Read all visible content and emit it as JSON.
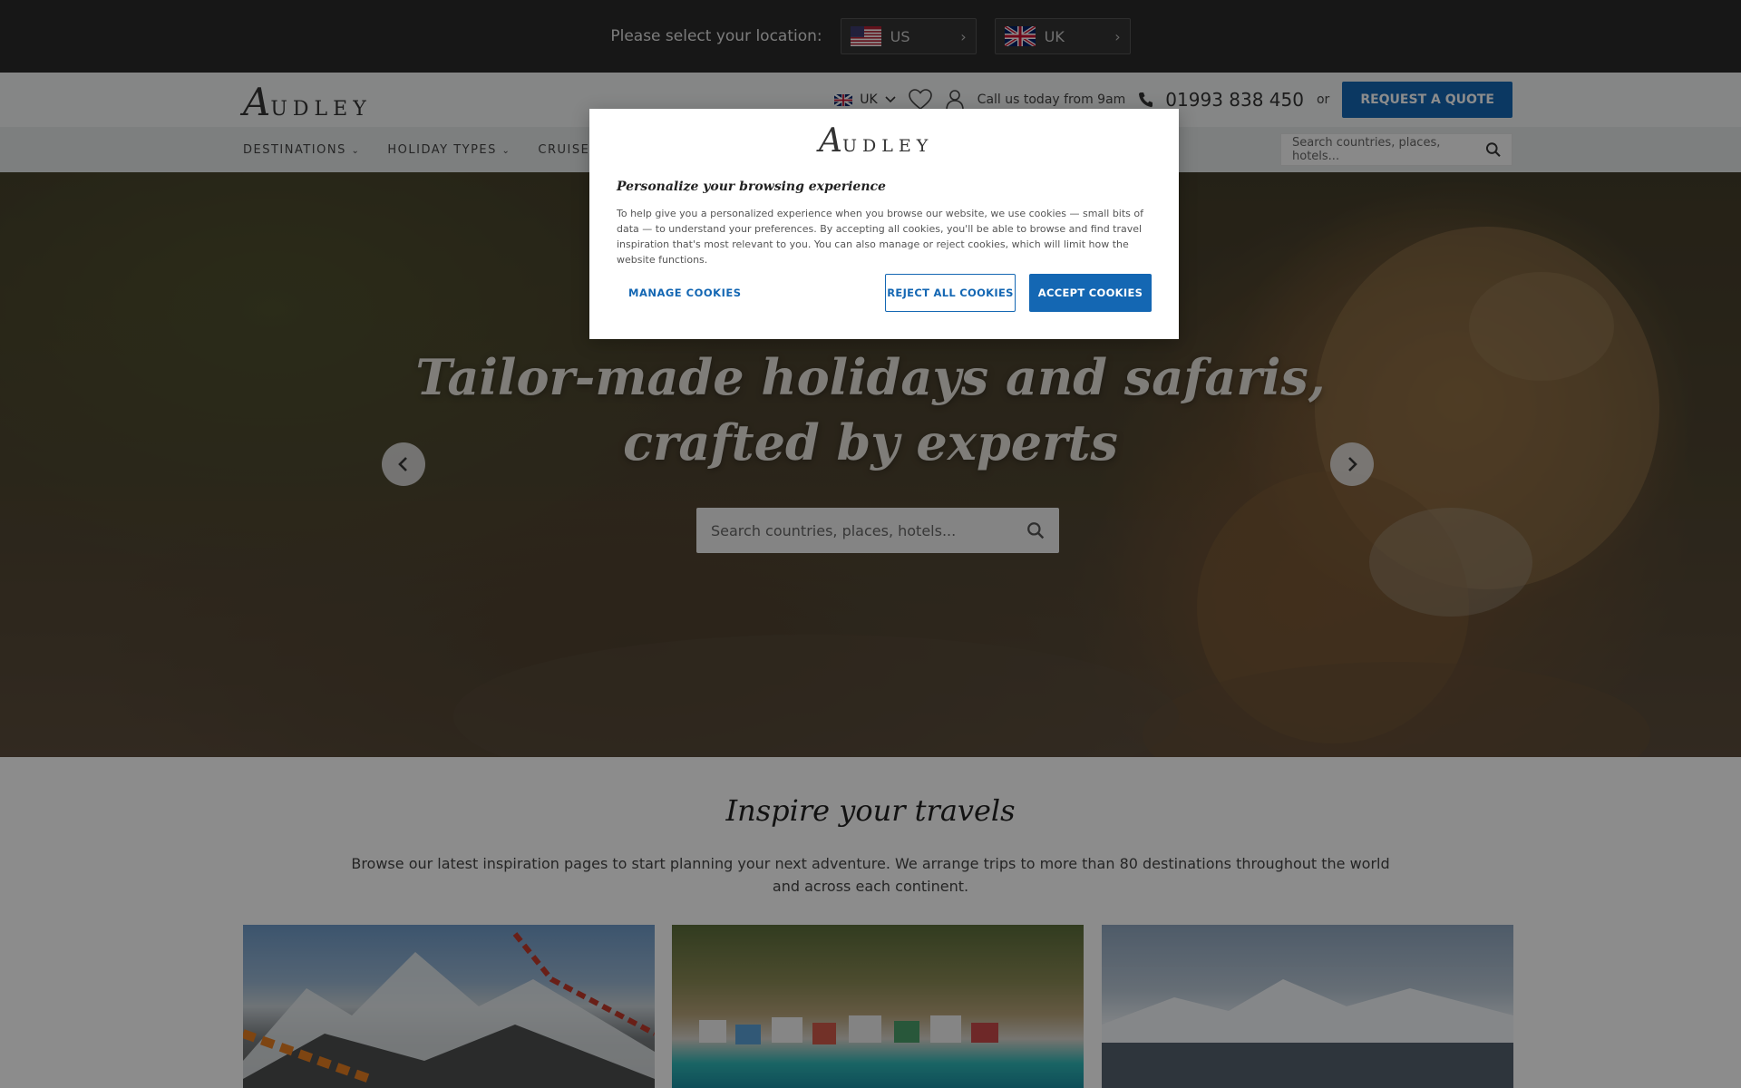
{
  "location_bar": {
    "prompt": "Please select your location:",
    "options": [
      {
        "label": "US",
        "flag": "us-flag-icon"
      },
      {
        "label": "UK",
        "flag": "uk-flag-icon"
      }
    ]
  },
  "header": {
    "logo_initial": "A",
    "logo_rest": "UDLEY",
    "region": "UK",
    "call_text": "Call us today from 9am",
    "phone": "01993 838 450",
    "or_text": "or",
    "quote_label": "REQUEST A QUOTE"
  },
  "nav": {
    "items": [
      "DESTINATIONS",
      "HOLIDAY TYPES",
      "CRUISES"
    ],
    "search_placeholder": "Search countries, places, hotels..."
  },
  "hero": {
    "title_line1": "Tailor-made holidays and safaris,",
    "title_line2": "crafted by experts",
    "search_placeholder": "Search countries, places, hotels..."
  },
  "inspire": {
    "heading": "Inspire your travels",
    "text": "Browse our latest inspiration pages to start planning your next adventure. We arrange trips to more than 80 destinations throughout the world and across each continent."
  },
  "cookie_modal": {
    "logo_initial": "A",
    "logo_rest": "UDLEY",
    "title": "Personalize your browsing experience",
    "body": "To help give you a personalized experience when you browse our website, we use cookies — small bits of data — to understand your preferences. By accepting all cookies, you'll be able to browse and find travel inspiration that's most relevant to you. You can also manage or reject cookies, which will limit how the website functions.",
    "manage_label": "MANAGE COOKIES",
    "reject_label": "REJECT ALL COOKIES",
    "accept_label": "ACCEPT COOKIES"
  },
  "colors": {
    "brand_blue": "#1467b3",
    "location_bar_bg": "#2b2b2b",
    "nav_bg": "#e3e7e8"
  }
}
